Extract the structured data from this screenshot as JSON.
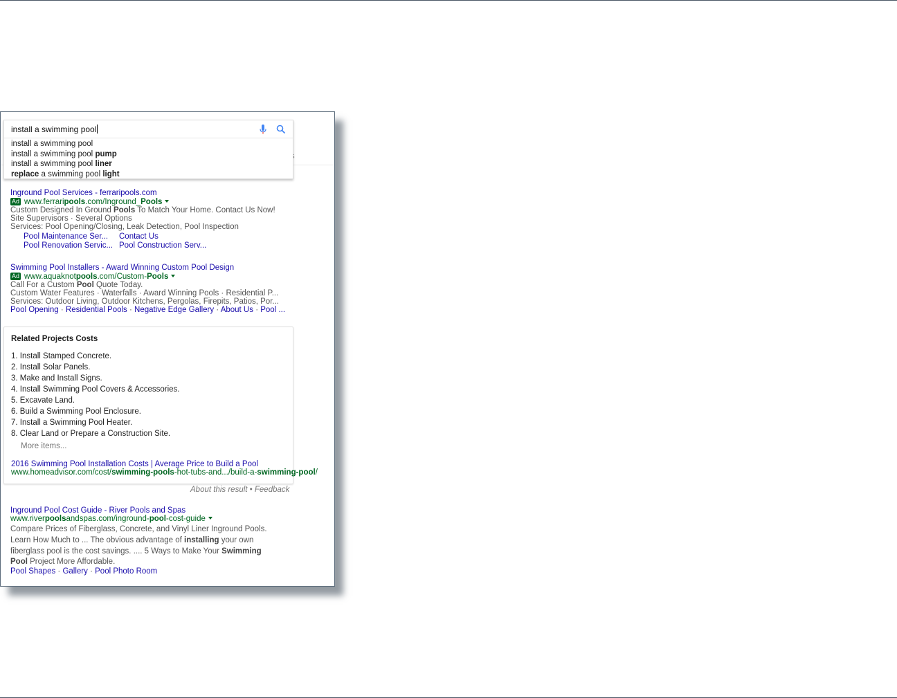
{
  "search": {
    "query": "install a swimming pool",
    "suggestions": [
      {
        "plain_before": "install a swimming pool",
        "bold": ""
      },
      {
        "plain_before": "install a swimming pool ",
        "bold": "pump"
      },
      {
        "plain_before": "install a swimming pool ",
        "bold": "liner"
      },
      {
        "bold_first": "replace",
        "plain_mid": " a swimming pool ",
        "bold_last": "light"
      }
    ],
    "tab_peek": "ls"
  },
  "ads": [
    {
      "title": "Inground Pool Services - ferraripools.com",
      "badge": "Ad",
      "url_pre": "www.ferrari",
      "url_bold": "pools",
      "url_mid": ".com/Inground_",
      "url_bold2": "Pools",
      "desc1_pre": "Custom Designed In Ground ",
      "desc1_bold": "Pools",
      "desc1_post": " To Match Your Home. Contact Us Now!",
      "desc2": "Site Supervisors · Several Options",
      "desc3": "Services: Pool Opening/Closing, Leak Detection, Pool Inspection",
      "sitelinks": [
        "Pool Maintenance Ser...",
        "Contact Us",
        "Pool Renovation Servic...",
        "Pool Construction Serv..."
      ]
    },
    {
      "title": "Swimming Pool Installers - Award Winning Custom Pool Design",
      "badge": "Ad",
      "url_pre": "www.aquaknot",
      "url_bold": "pools",
      "url_mid": ".com/Custom-",
      "url_bold2": "Pools",
      "desc1_pre": "Call For a Custom ",
      "desc1_bold": "Pool",
      "desc1_post": " Quote Today.",
      "desc2": "Custom Water Features · Waterfalls · Award Winning Pools · Residential P...",
      "desc3": "Services: Outdoor Living, Outdoor Kitchens, Pergolas, Firepits, Patios, Por...",
      "inline_links": [
        "Pool Opening",
        "Residential Pools",
        "Negative Edge Gallery",
        "About Us",
        "Pool ..."
      ]
    }
  ],
  "featured": {
    "title": "Related Projects Costs",
    "items": [
      "1. Install Stamped Concrete.",
      "2. Install Solar Panels.",
      "3. Make and Install Signs.",
      "4. Install Swimming Pool Covers & Accessories.",
      "5. Excavate Land.",
      "6. Build a Swimming Pool Enclosure.",
      "7. Install a Swimming Pool Heater.",
      "8. Clear Land or Prepare a Construction Site."
    ],
    "more": "More items...",
    "link_title": "2016 Swimming Pool Installation Costs | Average Price to Build a Pool",
    "url_pre": "www.homeadvisor.com/cost/",
    "url_bold": "swimming-pools",
    "url_mid": "-hot-tubs-and.../build-a-",
    "url_bold2": "swimming-pool",
    "url_post": "/",
    "about": "About this result",
    "sep": " • ",
    "feedback": "Feedback"
  },
  "organic": {
    "title": "Inground Pool Cost Guide - River Pools and Spas",
    "url_pre": "www.river",
    "url_bold": "pools",
    "url_mid": "andspas.com/inground-",
    "url_bold2": "pool",
    "url_post": "-cost-guide",
    "desc1": "Compare Prices of Fiberglass, Concrete, and Vinyl Liner Inground Pools.",
    "desc2_pre": "Learn How Much to ... The obvious advantage of ",
    "desc2_bold": "installing",
    "desc2_post": " your own",
    "desc3_pre": "fiberglass pool is the cost savings. .... 5 Ways to Make Your ",
    "desc3_bold": "Swimming",
    "desc4_bold": "Pool",
    "desc4_post": " Project More Affordable.",
    "links": [
      "Pool Shapes",
      "Gallery",
      "Pool Photo Room"
    ]
  },
  "colors": {
    "link": "#1a0dab",
    "url_green": "#006621",
    "snippet": "#545454",
    "frame_border": "#5a6a7a"
  }
}
